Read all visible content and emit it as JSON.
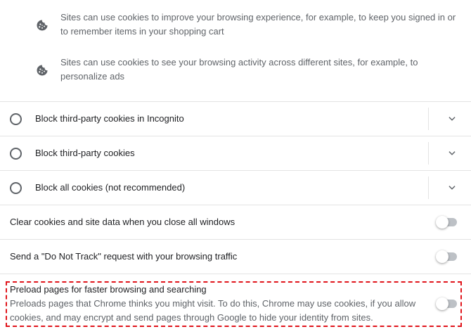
{
  "cookie_info": [
    {
      "icon": "cookie-icon",
      "text": "Sites can use cookies to improve your browsing experience, for example, to keep you signed in or to remember items in your shopping cart"
    },
    {
      "icon": "cookie-icon",
      "text": "Sites can use cookies to see your browsing activity across different sites, for example, to personalize ads"
    }
  ],
  "radio_options": [
    {
      "label": "Block third-party cookies in Incognito",
      "selected": false
    },
    {
      "label": "Block third-party cookies",
      "selected": false
    },
    {
      "label": "Block all cookies (not recommended)",
      "selected": false
    }
  ],
  "toggles": [
    {
      "label": "Clear cookies and site data when you close all windows",
      "enabled": false
    },
    {
      "label": "Send a \"Do Not Track\" request with your browsing traffic",
      "enabled": false
    }
  ],
  "preload": {
    "title": "Preload pages for faster browsing and searching",
    "description": "Preloads pages that Chrome thinks you might visit. To do this, Chrome may use cookies, if you allow cookies, and may encrypt and send pages through Google to hide your identity from sites.",
    "enabled": false
  },
  "colors": {
    "highlight_border": "#e0141b",
    "secondary_text": "#5f6368",
    "toggle_track_off": "#bdc1c6"
  }
}
